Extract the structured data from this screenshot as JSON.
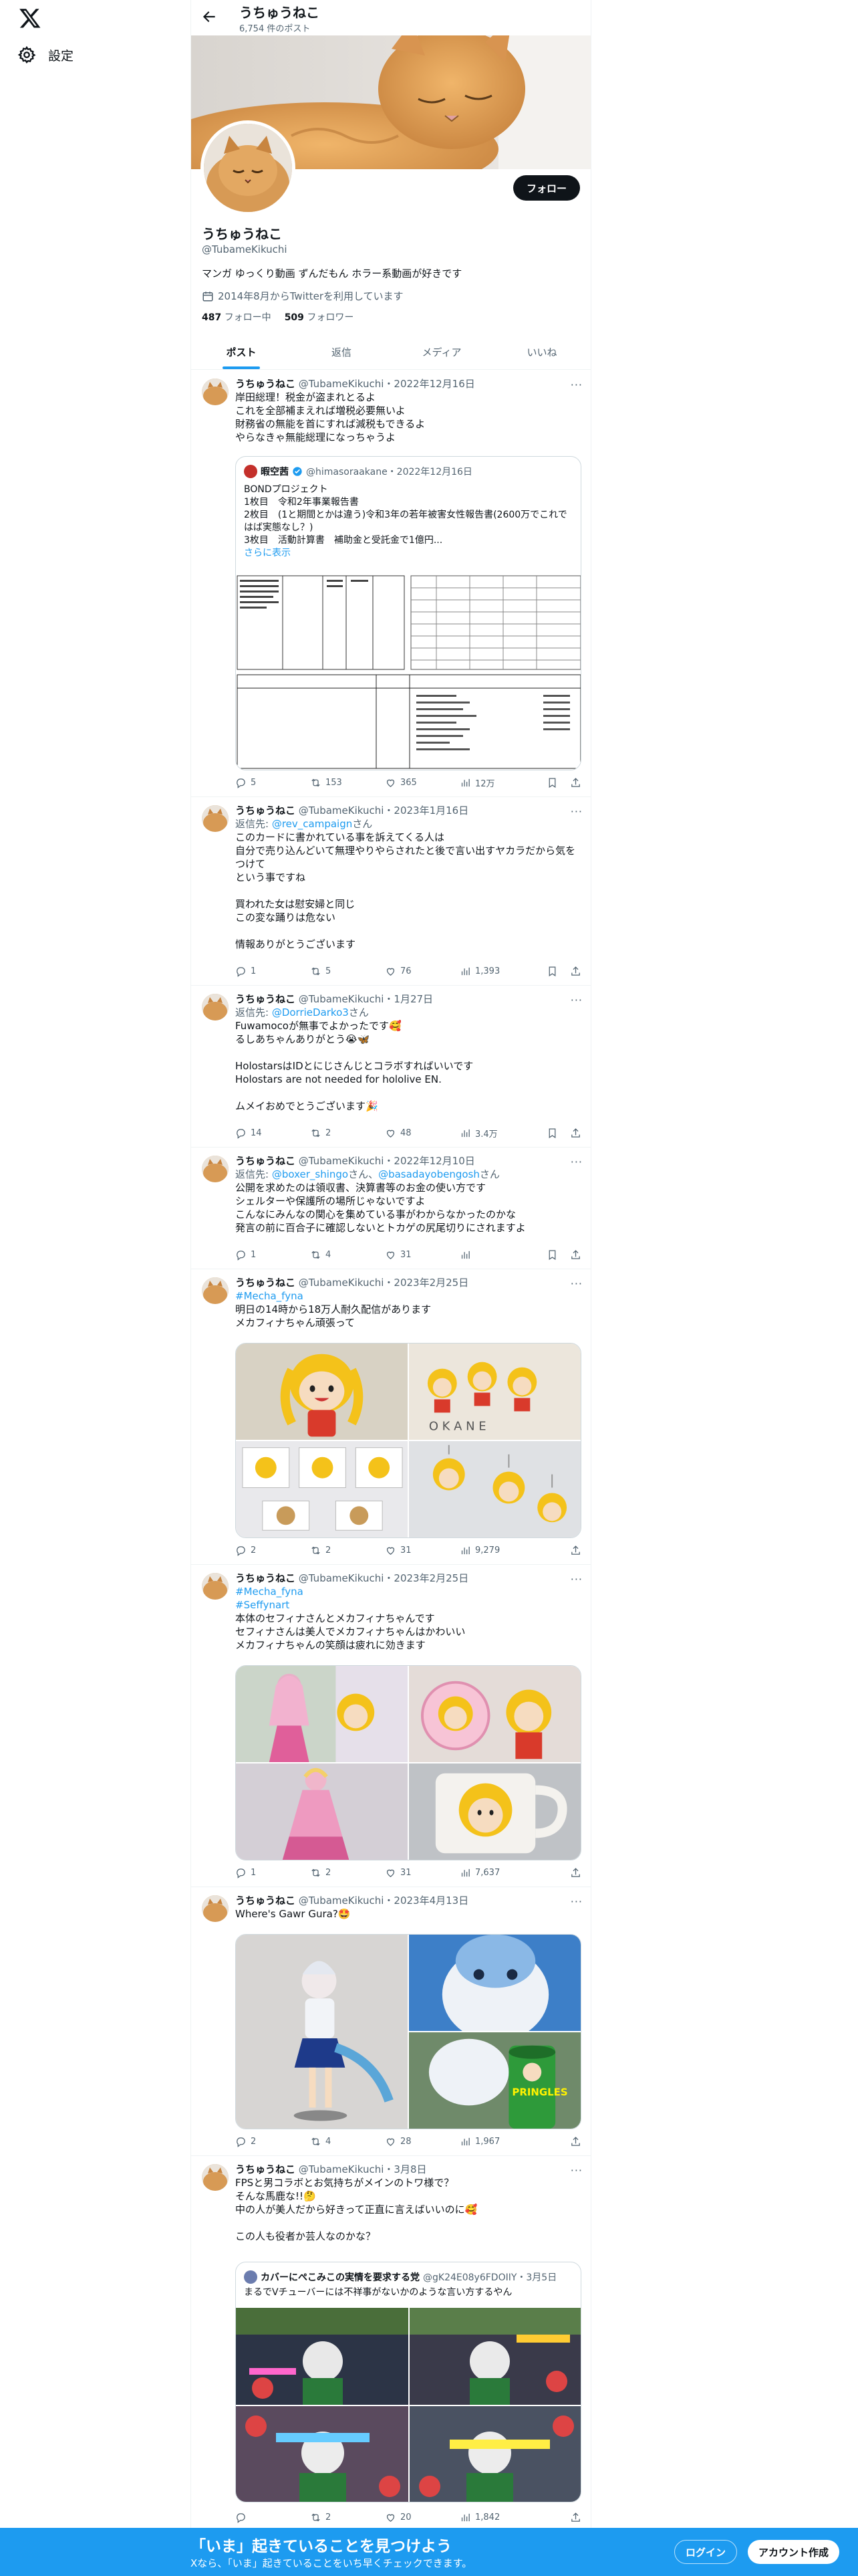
{
  "nav": {
    "settings_label": "設定"
  },
  "header": {
    "name": "うちゅうねこ",
    "post_count": "6,754 件のポスト"
  },
  "profile": {
    "name": "うちゅうねこ",
    "handle": "@TubameKikuchi",
    "bio": "マンガ ゆっくり動画 ずんだもん ホラー系動画が好きです",
    "joined": "2014年8月からTwitterを利用しています",
    "following_count": "487",
    "following_label": "フォロー中",
    "followers_count": "509",
    "followers_label": "フォロワー",
    "follow_button": "フォロー"
  },
  "tabs": [
    "ポスト",
    "返信",
    "メディア",
    "いいね"
  ],
  "tweets": [
    {
      "name": "うちゅうねこ",
      "meta": "@TubameKikuchi・2022年12月16日",
      "text": "岸田総理！税金が盗まれとるよ\nこれを全部補まえれば増税必要無いよ\n財務省の無能を首にすれば減税もできるよ\nやらなきゃ無能総理になっちゃうよ",
      "quote": {
        "name": "暇空茜",
        "meta": "@himasoraakane・2022年12月16日",
        "text": "BONDプロジェクト\n1枚目　令和2年事業報告書\n2枚目　(1と期間とかは違う)令和3年の若年被害女性報告書(2600万でこれではば実態なし？)\n3枚目　活動計算書　補助金と受託金で1億円...",
        "more": "さらに表示"
      },
      "stats": {
        "reply": "5",
        "retweet": "153",
        "like": "365",
        "views": "12万"
      }
    },
    {
      "name": "うちゅうねこ",
      "meta": "@TubameKikuchi・2023年1月16日",
      "reply_prefix": "返信先: ",
      "reply_to": "@rev_campaign",
      "reply_suffix": "さん",
      "text": "このカードに書かれている事を訴えてくる人は\n自分で売り込んどいて無理やりやらされたと後で言い出すヤカラだから気をつけて\nという事ですね\n\n買われた女は慰安婦と同じ\nこの変な踊りは危ない\n\n情報ありがとうございます",
      "stats": {
        "reply": "1",
        "retweet": "5",
        "like": "76",
        "views": "1,393"
      }
    },
    {
      "name": "うちゅうねこ",
      "meta": "@TubameKikuchi・1月27日",
      "reply_prefix": "返信先: ",
      "reply_to": "@DorrieDarko3",
      "reply_suffix": "さん",
      "text": "Fuwamocoが無事でよかったです🥰\nるしあちゃんありがとう😭🦋\n\nHolostarsはIDとにじさんじとコラボすればいいです\nHolostars are not needed for hololive EN.\n\nムメイおめでとうございます🎉",
      "stats": {
        "reply": "14",
        "retweet": "2",
        "like": "48",
        "views": "3.4万"
      }
    },
    {
      "name": "うちゅうねこ",
      "meta": "@TubameKikuchi・2022年12月10日",
      "reply_prefix": "返信先: ",
      "reply_to": "@boxer_shingo",
      "reply_mid": "さん、",
      "reply_to2": "@basadayobengosh",
      "reply_suffix": "さん",
      "text": "公開を求めたのは領収書、決算書等のお金の使い方です\nシェルターや保護所の場所じゃないですよ\nこんなにみんなの関心を集めている事がわからなかったのかな\n発言の前に百合子に確認しないとトカゲの尻尾切りにされますよ",
      "stats": {
        "reply": "1",
        "retweet": "4",
        "like": "31",
        "views": ""
      }
    },
    {
      "name": "うちゅうねこ",
      "meta": "@TubameKikuchi・2023年2月25日",
      "hashtag": "#Mecha_fyna",
      "text": "明日の14時から18万人耐久配信があります\nメカフィナちゃん頑張って",
      "stats": {
        "reply": "2",
        "retweet": "2",
        "like": "31",
        "views": "9,279"
      }
    },
    {
      "name": "うちゅうねこ",
      "meta": "@TubameKikuchi・2023年2月25日",
      "hashtag": "#Mecha_fyna",
      "hashtag2": "#Seffynart",
      "text": "本体のセフィナさんとメカフィナちゃんです\nセフィナさんは美人でメカフィナちゃんはかわいい\nメカフィナちゃんの笑顔は疲れに効きます",
      "stats": {
        "reply": "1",
        "retweet": "2",
        "like": "31",
        "views": "7,637"
      }
    },
    {
      "name": "うちゅうねこ",
      "meta": "@TubameKikuchi・2023年4月13日",
      "text": "Where's Gawr Gura?🤩",
      "stats": {
        "reply": "2",
        "retweet": "4",
        "like": "28",
        "views": "1,967"
      }
    },
    {
      "name": "うちゅうねこ",
      "meta": "@TubameKikuchi・3月8日",
      "text": "FPSと男コラボとお気持ちがメインのトワ様で？\nそんな馬鹿な!!🤔\n中の人が美人だから好きって正直に言えばいいのに🥰\n\nこの人も役者か芸人なのかな？",
      "quote": {
        "name": "カバーにぺこみこの実情を要求する党",
        "meta": "@gK24E08y6FDOIIY・3月5日",
        "text": "まるでVチューバーには不祥事がないかのような言い方するやん"
      },
      "stats": {
        "reply": "",
        "retweet": "2",
        "like": "20",
        "views": "1,842"
      }
    }
  ],
  "bottom_bar": {
    "title": "「いま」起きていることを見つけよう",
    "subtitle": "Xなら、「いま」起きていることをいち早くチェックできます。",
    "login": "ログイン",
    "signup": "アカウント作成"
  },
  "colors": {
    "accent": "#1d9bf0",
    "text": "#0f1419",
    "muted": "#536471"
  }
}
